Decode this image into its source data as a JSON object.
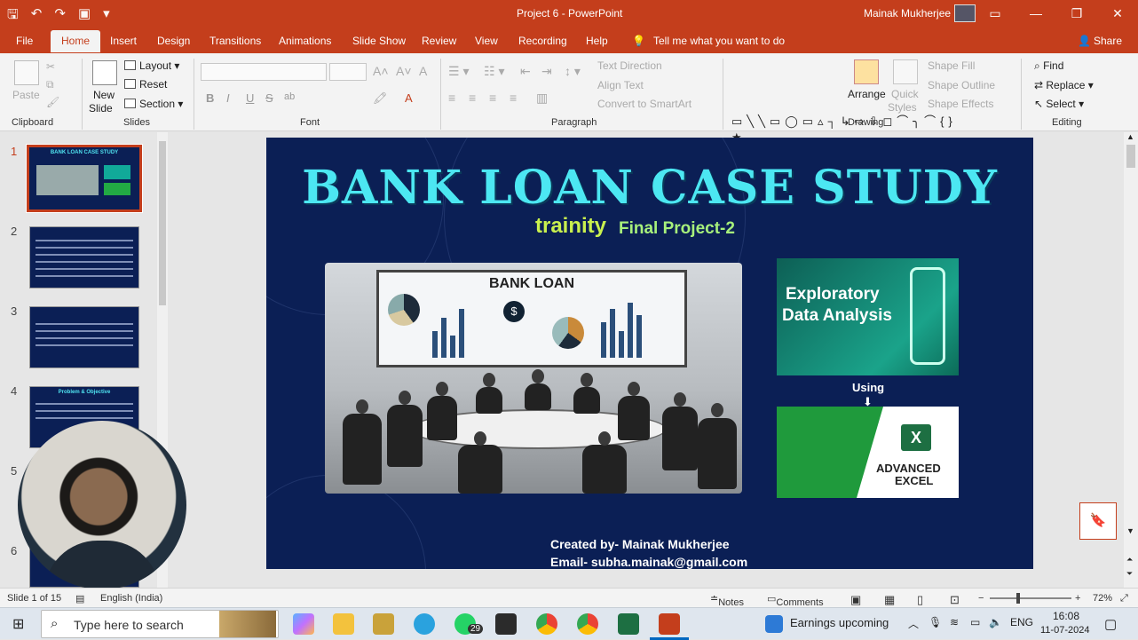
{
  "window": {
    "title": "Project 6  -  PowerPoint",
    "user": "Mainak Mukherjee",
    "controls": {
      "minimize": "—",
      "restore": "❐",
      "close": "✕"
    }
  },
  "quick_access": {
    "save": "🖫",
    "undo": "↶",
    "redo": "↷",
    "present": "▣",
    "customize": "▾"
  },
  "tabs": [
    "File",
    "Home",
    "Insert",
    "Design",
    "Transitions",
    "Animations",
    "Slide Show",
    "Review",
    "View",
    "Recording",
    "Help"
  ],
  "tell_me": "Tell me what you want to do",
  "share": "Share",
  "ribbon": {
    "clipboard": {
      "paste": "Paste",
      "group": "Clipboard"
    },
    "slides": {
      "new_slide_1": "New",
      "new_slide_2": "Slide",
      "layout": "Layout",
      "reset": "Reset",
      "section": "Section",
      "group": "Slides"
    },
    "font": {
      "group": "Font",
      "bold": "B",
      "italic": "I",
      "underline": "U",
      "strike": "S",
      "shadow": "ab",
      "grow": "A˄",
      "shrink": "A˅",
      "clear": "A"
    },
    "paragraph": {
      "group": "Paragraph",
      "text_direction": "Text Direction",
      "align_text": "Align Text",
      "smartart": "Convert to SmartArt"
    },
    "drawing": {
      "group": "Drawing",
      "arrange": "Arrange",
      "quick_styles_1": "Quick",
      "quick_styles_2": "Styles",
      "shape_fill": "Shape Fill",
      "shape_outline": "Shape Outline",
      "shape_effects": "Shape Effects",
      "shapes": "▭╲╲▭◯▭▵┐↳⇨⇩◻⌒╮⌒{}★"
    },
    "editing": {
      "group": "Editing",
      "find": "Find",
      "replace": "Replace",
      "select": "Select"
    }
  },
  "thumbnails": {
    "numbers": [
      "1",
      "2",
      "3",
      "4",
      "5",
      "6"
    ],
    "thumb1_title": "BANK LOAN CASE STUDY",
    "thumb4_title": "Problem & Objective"
  },
  "slide": {
    "title": "BANK LOAN CASE STUDY",
    "brand": "trainity",
    "subtitle": "Final Project-2",
    "board_label": "BANK LOAN",
    "eda_line1": "Exploratory",
    "eda_line2": "Data Analysis",
    "using": "Using",
    "using_arrow": "⬇",
    "excel_icon": "X",
    "excel_line1": "ADVANCED",
    "excel_line2": "EXCEL",
    "created_by": "Created by- Mainak Mukherjee",
    "email": "Email- subha.mainak@gmail.com"
  },
  "status": {
    "slide_counter": "Slide 1 of 15",
    "language": "English (India)",
    "notes": "Notes",
    "comments": "Comments",
    "zoom": "72%"
  },
  "taskbar": {
    "search_placeholder": "Type here to search",
    "whatsapp_badge": "29",
    "news": "Earnings upcoming",
    "lang": "ENG",
    "time": "16:08",
    "date": "11-07-2024"
  }
}
